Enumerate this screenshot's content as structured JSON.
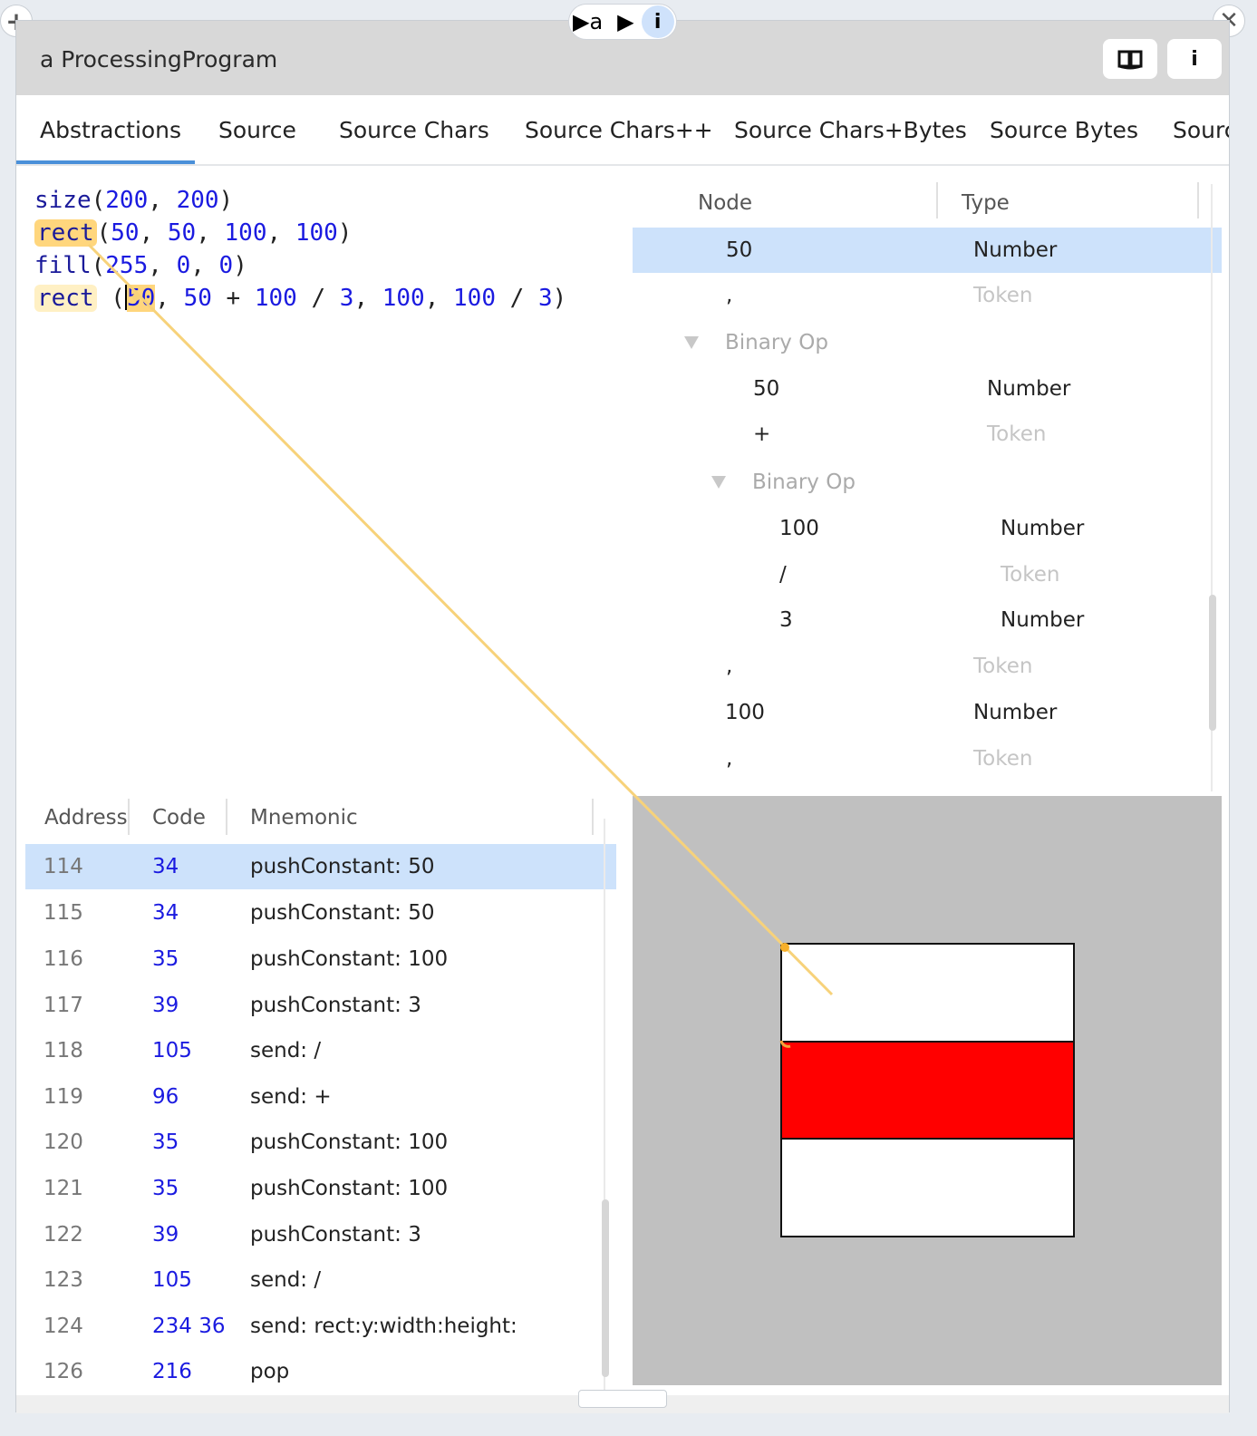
{
  "top_pill": {
    "label": "▶a"
  },
  "window": {
    "title": "a ProcessingProgram"
  },
  "tabs": [
    "Abstractions",
    "Source",
    "Source Chars",
    "Source Chars++",
    "Source Chars+Bytes",
    "Source Bytes",
    "Sourc"
  ],
  "code": {
    "line1": {
      "fn": "size",
      "args": [
        "200",
        "200"
      ]
    },
    "line2": {
      "fn": "rect",
      "args": [
        "50",
        "50",
        "100",
        "100"
      ]
    },
    "line3": {
      "fn": "fill",
      "args": [
        "255",
        "0",
        "0"
      ]
    },
    "line4": {
      "fn": "rect",
      "a1": "50",
      "a2": "50",
      "op1": "+",
      "a3": "100",
      "op2": "/",
      "a4": "3",
      "a5": "100",
      "a6": "100",
      "op3": "/",
      "a7": "3"
    }
  },
  "ast": {
    "headers": {
      "node": "Node",
      "type": "Type"
    },
    "rows": [
      {
        "node": "50",
        "type": "Number"
      },
      {
        "node": ",",
        "type": "Token"
      },
      {
        "node": "Binary Op",
        "type": ""
      },
      {
        "node": "50",
        "type": "Number"
      },
      {
        "node": "+",
        "type": "Token"
      },
      {
        "node": "Binary Op",
        "type": ""
      },
      {
        "node": "100",
        "type": "Number"
      },
      {
        "node": "/",
        "type": "Token"
      },
      {
        "node": "3",
        "type": "Number"
      },
      {
        "node": ",",
        "type": "Token"
      },
      {
        "node": "100",
        "type": "Number"
      },
      {
        "node": ",",
        "type": "Token"
      }
    ]
  },
  "bytecode": {
    "headers": {
      "address": "Address",
      "code": "Code",
      "mnemonic": "Mnemonic"
    },
    "rows": [
      {
        "address": "114",
        "code": "34",
        "mnemonic": "pushConstant: 50"
      },
      {
        "address": "115",
        "code": "34",
        "mnemonic": "pushConstant: 50"
      },
      {
        "address": "116",
        "code": "35",
        "mnemonic": "pushConstant: 100"
      },
      {
        "address": "117",
        "code": "39",
        "mnemonic": "pushConstant: 3"
      },
      {
        "address": "118",
        "code": "105",
        "mnemonic": "send: /"
      },
      {
        "address": "119",
        "code": "96",
        "mnemonic": "send: +"
      },
      {
        "address": "120",
        "code": "35",
        "mnemonic": "pushConstant: 100"
      },
      {
        "address": "121",
        "code": "35",
        "mnemonic": "pushConstant: 100"
      },
      {
        "address": "122",
        "code": "39",
        "mnemonic": "pushConstant: 3"
      },
      {
        "address": "123",
        "code": "105",
        "mnemonic": "send: /"
      },
      {
        "address": "124",
        "code": "234 36",
        "mnemonic": "send: rect:y:width:height:"
      },
      {
        "address": "126",
        "code": "216",
        "mnemonic": "pop"
      }
    ]
  },
  "colors": {
    "selection": "#cde2fb",
    "highlight": "#ffd67d",
    "link_line": "#f7d27a",
    "canvas_bg": "#c0c0c0",
    "fill_red": "#ff0000",
    "number_blue": "#1a1ae0"
  },
  "icons": {
    "add": "plus-icon",
    "close": "close-icon",
    "play": "play-icon",
    "info": "info-icon",
    "book": "book-icon"
  }
}
